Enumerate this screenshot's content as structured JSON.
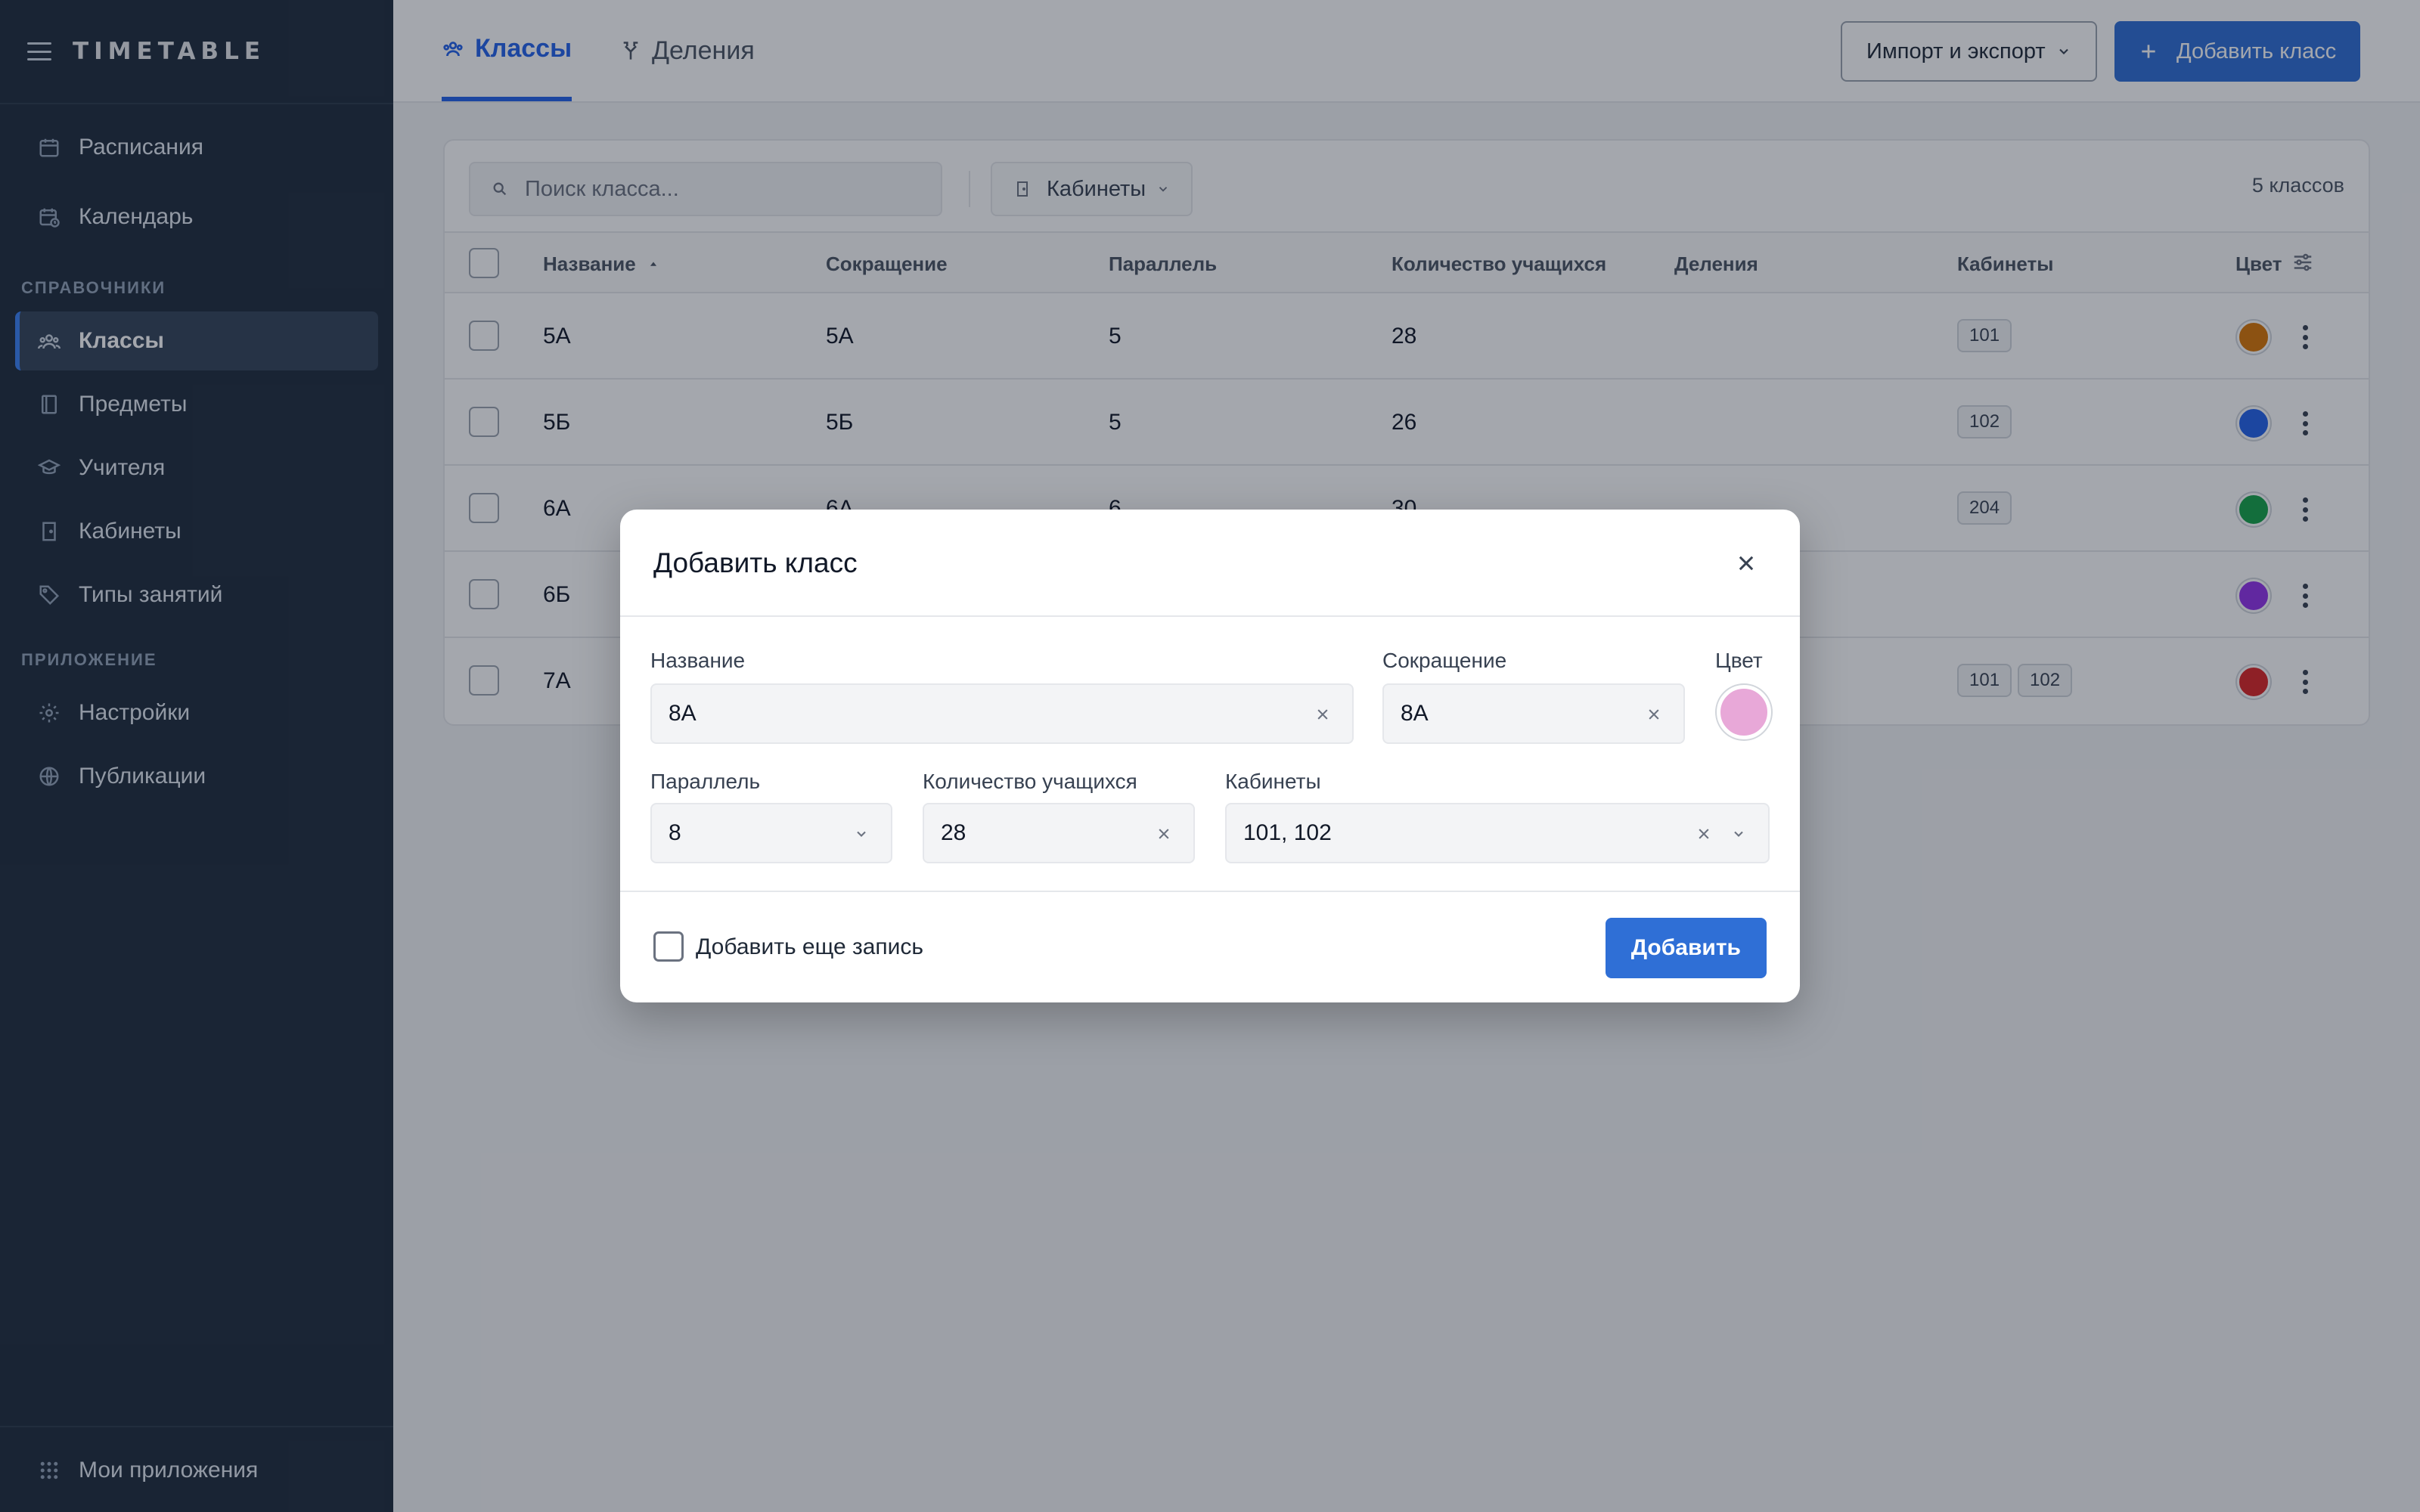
{
  "app": {
    "brand": "TIMETABLE"
  },
  "sidebar": {
    "items_top": [
      {
        "label": "Расписания",
        "icon": "calendar-icon"
      },
      {
        "label": "Календарь",
        "icon": "calendar-clock-icon"
      }
    ],
    "section_refs": "СПРАВОЧНИКИ",
    "items_refs": [
      {
        "label": "Классы",
        "icon": "users-icon",
        "active": true
      },
      {
        "label": "Предметы",
        "icon": "book-icon"
      },
      {
        "label": "Учителя",
        "icon": "graduation-cap-icon"
      },
      {
        "label": "Кабинеты",
        "icon": "door-icon"
      },
      {
        "label": "Типы занятий",
        "icon": "tag-icon"
      }
    ],
    "section_app": "ПРИЛОЖЕНИЕ",
    "items_app": [
      {
        "label": "Настройки",
        "icon": "gear-icon"
      },
      {
        "label": "Публикации",
        "icon": "globe-icon"
      }
    ],
    "bottom": {
      "label": "Мои приложения",
      "icon": "grid-icon"
    }
  },
  "topbar": {
    "tabs": [
      {
        "label": "Классы",
        "icon": "users-icon",
        "active": true
      },
      {
        "label": "Деления",
        "icon": "split-icon",
        "active": false
      }
    ],
    "import_export": "Импорт и экспорт",
    "add_class": "Добавить класс"
  },
  "table": {
    "search_placeholder": "Поиск класса...",
    "filter_label": "Кабинеты",
    "count": "5 классов",
    "columns": [
      "Название",
      "Сокращение",
      "Параллель",
      "Количество учащихся",
      "Деления",
      "Кабинеты",
      "Цвет"
    ],
    "rows": [
      {
        "name": "5А",
        "short": "5А",
        "grade": "5",
        "students": "28",
        "rooms": [
          "101"
        ],
        "color": "#d97706"
      },
      {
        "name": "5Б",
        "short": "5Б",
        "grade": "5",
        "students": "26",
        "rooms": [
          "102"
        ],
        "color": "#2563eb"
      },
      {
        "name": "6А",
        "short": "6А",
        "grade": "6",
        "students": "30",
        "rooms": [
          "204"
        ],
        "color": "#16a34a"
      },
      {
        "name": "6Б",
        "short": "",
        "grade": "",
        "students": "",
        "rooms": [],
        "color": "#9333ea"
      },
      {
        "name": "7А",
        "short": "",
        "grade": "",
        "students": "",
        "rooms": [
          "101",
          "102"
        ],
        "color": "#dc2626"
      }
    ]
  },
  "modal": {
    "title": "Добавить класс",
    "name_label": "Название",
    "name_value": "8А",
    "short_label": "Сокращение",
    "short_value": "8А",
    "color_label": "Цвет",
    "color_value": "#e8a8d8",
    "grade_label": "Параллель",
    "grade_value": "8",
    "students_label": "Количество учащихся",
    "students_value": "28",
    "rooms_label": "Кабинеты",
    "rooms_value": "101, 102",
    "add_more_label": "Добавить еще запись",
    "submit_label": "Добавить"
  }
}
